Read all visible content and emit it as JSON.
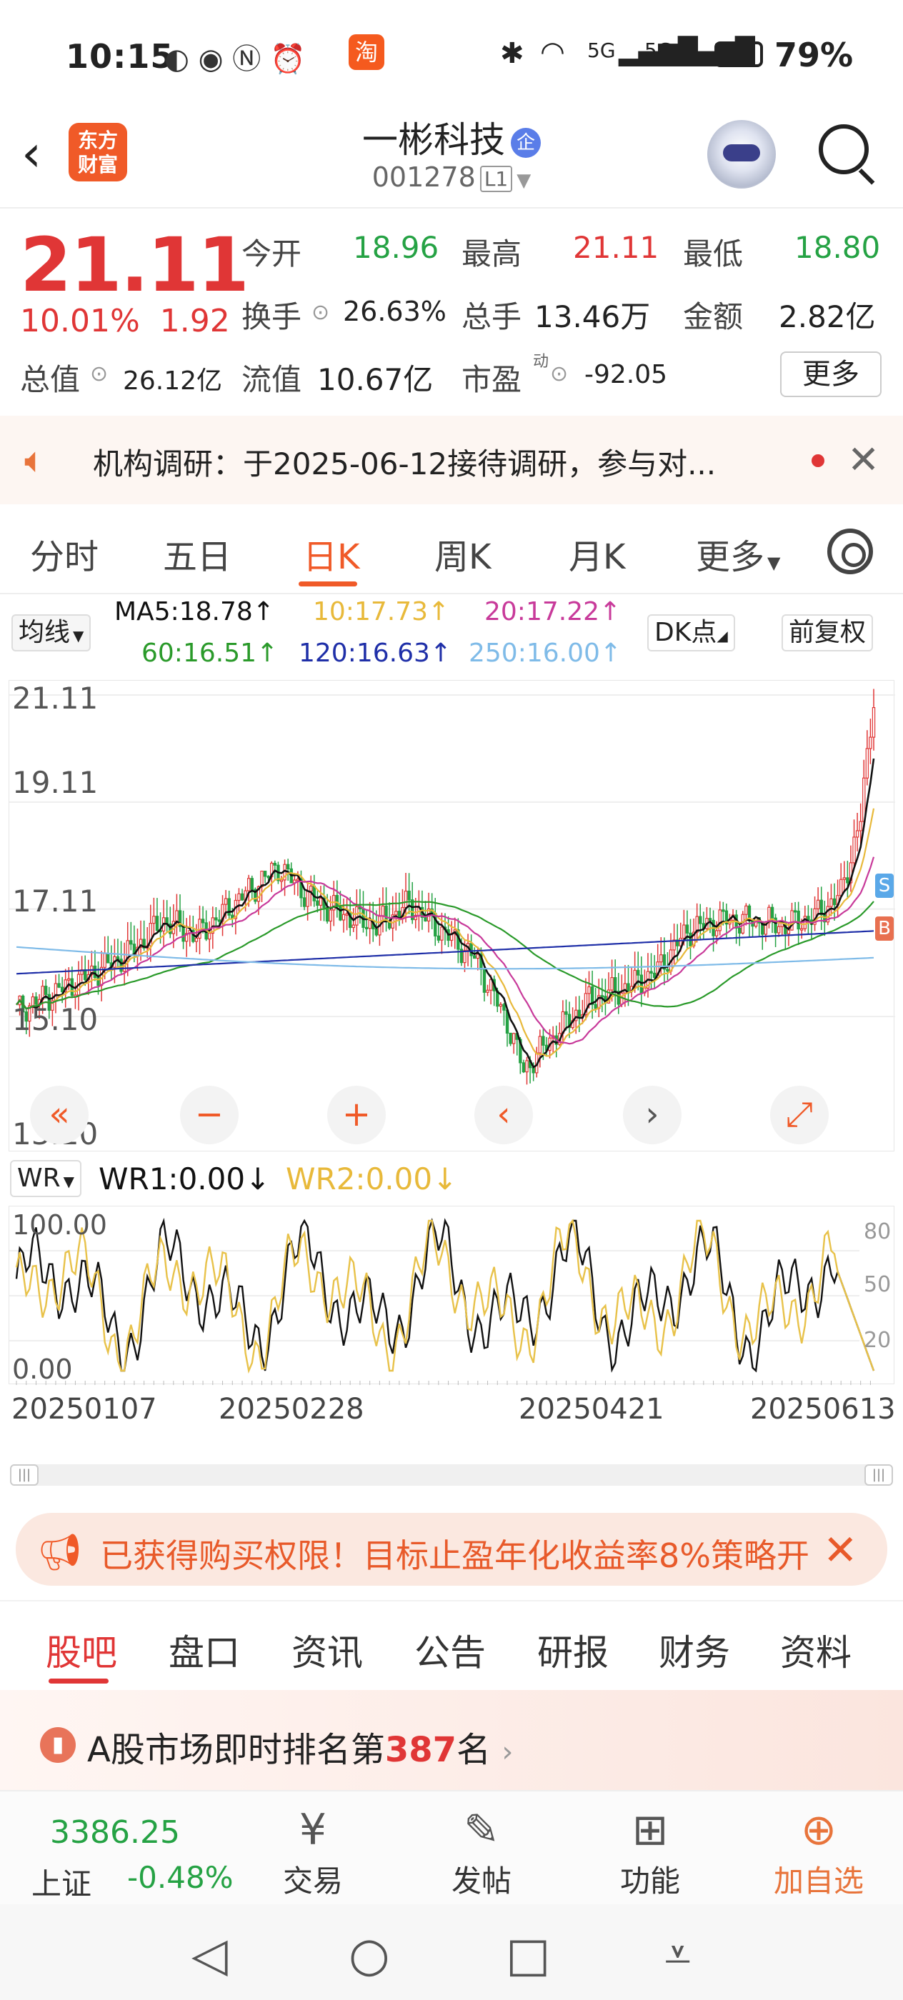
{
  "status": {
    "time": "10:15",
    "battery": "79%",
    "net1": "5G",
    "net2": "5G"
  },
  "header": {
    "logo": "东方\n财富",
    "title": "一彬科技",
    "badge": "企",
    "code": "001278",
    "level": "L1"
  },
  "quote": {
    "price": "21.11",
    "pct": "10.01%",
    "chg": "1.92",
    "open_l": "今开",
    "open": "18.96",
    "high_l": "最高",
    "high": "21.11",
    "low_l": "最低",
    "low": "18.80",
    "turn_l": "换手",
    "turn": "26.63%",
    "vol_l": "总手",
    "vol": "13.46万",
    "amt_l": "金额",
    "amt": "2.82亿",
    "mcap_l": "总值",
    "mcap": "26.12亿",
    "float_l": "流值",
    "float": "10.67亿",
    "pe_l": "市盈",
    "pe_sup": "动",
    "pe": "-92.05",
    "more": "更多"
  },
  "notice": {
    "text": "机构调研：于2025-06-12接待调研，参与对..."
  },
  "tabs": [
    "分时",
    "五日",
    "日K",
    "周K",
    "月K",
    "更多"
  ],
  "ma": {
    "type": "均线",
    "ma5": "MA5:18.78↑",
    "ma10": "10:17.73↑",
    "ma20": "20:17.22↑",
    "ma60": "60:16.51↑",
    "ma120": "120:16.63↑",
    "ma250": "250:16.00↑",
    "dk": "DK点",
    "fq": "前复权"
  },
  "colors": {
    "ma5": "#111111",
    "ma10": "#e8b93a",
    "ma20": "#c83a9a",
    "ma60": "#2a9a2a",
    "ma120": "#1f2fa8",
    "ma250": "#7fbbe8",
    "up": "#e03636",
    "down": "#25a244"
  },
  "axis": {
    "y1": "21.11",
    "y2": "19.11",
    "y3": "17.11",
    "y4": "15.10",
    "y5": "13.10",
    "wr_top": "100.00",
    "wr_bot": "0.00",
    "wr_r1": "80",
    "wr_r2": "50",
    "wr_r3": "20",
    "b_label": "B",
    "s_label": "S"
  },
  "wr": {
    "type": "WR",
    "wr1": "WR1:0.00↓",
    "wr2": "WR2:0.00↓"
  },
  "dates": [
    "20250107",
    "20250228",
    "20250421",
    "20250613"
  ],
  "promo": {
    "text": "已获得购买权限！目标止盈年化收益率8%策略开"
  },
  "subtabs": [
    "股吧",
    "盘口",
    "资讯",
    "公告",
    "研报",
    "财务",
    "资料"
  ],
  "rank": {
    "pre": "A股市场即时排名第",
    "num": "387",
    "post": "名"
  },
  "bottom": {
    "index_val": "3386.25",
    "index_name": "上证",
    "index_pct": "-0.48%",
    "items": [
      "交易",
      "发帖",
      "功能",
      "加自选"
    ]
  },
  "chart_data": {
    "type": "candlestick",
    "ylim": [
      13.1,
      21.11
    ],
    "y_ticks": [
      "21.11",
      "19.11",
      "17.11",
      "15.10",
      "13.10"
    ],
    "x_ticks": [
      "20250107",
      "20250228",
      "20250421",
      "20250613"
    ],
    "ma_latest": {
      "MA5": 18.78,
      "MA10": 17.73,
      "MA20": 17.22,
      "MA60": 16.51,
      "MA120": 16.63,
      "MA250": 16.0
    },
    "last_close": 21.11
  }
}
